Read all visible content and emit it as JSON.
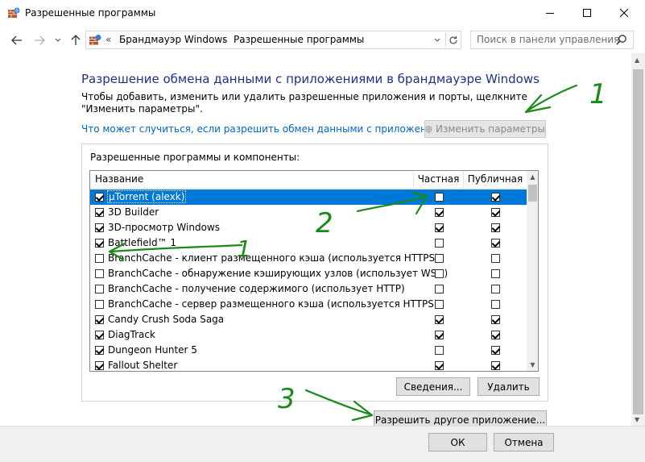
{
  "window": {
    "title": "Разрешенные программы",
    "minimize_icon": "minimize-icon",
    "maximize_icon": "maximize-icon",
    "close_icon": "close-icon"
  },
  "nav": {
    "back_icon": "arrow-left-icon",
    "forward_icon": "arrow-right-icon",
    "recent_icon": "chevron-down-icon",
    "up_icon": "arrow-up-icon"
  },
  "address": {
    "overflow": "«",
    "crumbs": [
      "Брандмауэр Windows",
      "Разрешенные программы"
    ],
    "separator": "›",
    "refresh_icon": "refresh-icon"
  },
  "search": {
    "placeholder": "Поиск в панели управления",
    "icon": "search-icon"
  },
  "content": {
    "heading": "Разрешение обмена данными с приложениями в брандмауэре Windows",
    "description": "Чтобы добавить, изменить или удалить разрешенные приложения и порты, щелкните \"Изменить параметры\".",
    "risk_link": "Что может случиться, если разрешить обмен данными с приложением?",
    "change_settings_label": "Изменить параметры",
    "group_label": "Разрешенные программы и компоненты:"
  },
  "table": {
    "columns": [
      "Название",
      "Частная",
      "Публичная"
    ],
    "rows": [
      {
        "name": "µTorrent (alexk)",
        "enabled": true,
        "private": false,
        "public": true,
        "selected": true
      },
      {
        "name": "3D Builder",
        "enabled": true,
        "private": true,
        "public": true
      },
      {
        "name": "3D-просмотр Windows",
        "enabled": true,
        "private": true,
        "public": true
      },
      {
        "name": "Battlefield™ 1",
        "enabled": true,
        "private": false,
        "public": true
      },
      {
        "name": "BranchCache - клиент размещенного кэша (используется HTTPS)",
        "enabled": false,
        "private": false,
        "public": false
      },
      {
        "name": "BranchCache - обнаружение кэширующих узлов (использует WSD)",
        "enabled": false,
        "private": false,
        "public": false
      },
      {
        "name": "BranchCache - получение содержимого (использует HTTP)",
        "enabled": false,
        "private": false,
        "public": false
      },
      {
        "name": "BranchCache - сервер размещенного кэша (используется HTTPS)",
        "enabled": false,
        "private": false,
        "public": false
      },
      {
        "name": "Candy Crush Soda Saga",
        "enabled": true,
        "private": true,
        "public": true
      },
      {
        "name": "DiagTrack",
        "enabled": true,
        "private": true,
        "public": true
      },
      {
        "name": "Dungeon Hunter 5",
        "enabled": true,
        "private": false,
        "public": true
      },
      {
        "name": "Fallout Shelter",
        "enabled": true,
        "private": true,
        "public": true
      }
    ]
  },
  "buttons": {
    "details": "Сведения...",
    "delete": "Удалить",
    "allow_other": "Разрешить другое приложение...",
    "ok": "ОК",
    "cancel": "Отмена"
  },
  "annotations": {
    "color": "#1a8a1a",
    "labels": [
      "1",
      "1",
      "2",
      "3"
    ]
  }
}
